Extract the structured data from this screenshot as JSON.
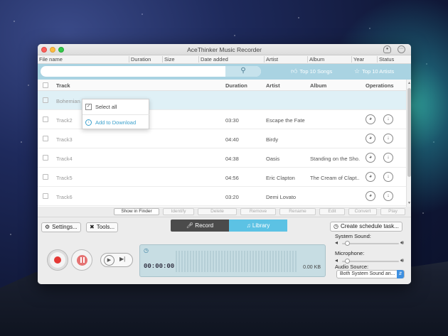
{
  "window": {
    "title": "AceThinker Music Recorder"
  },
  "columns_top": [
    "File name",
    "Duration",
    "Size",
    "Date added",
    "Artist",
    "Album",
    "Year",
    "Status"
  ],
  "search": {
    "placeholder": "",
    "top_songs": "Top 10 Songs",
    "top_artists": "Top 10 Artists"
  },
  "table": {
    "headers": {
      "track": "Track",
      "duration": "Duration",
      "artist": "Artist",
      "album": "Album",
      "operations": "Operations"
    },
    "rows": [
      {
        "track": "Bohemian Rhapsody",
        "duration": "",
        "artist": "",
        "album": "",
        "selected": true
      },
      {
        "track": "Track2",
        "duration": "03:30",
        "artist": "Escape the Fate",
        "album": ""
      },
      {
        "track": "Track3",
        "duration": "04:40",
        "artist": "Birdy",
        "album": ""
      },
      {
        "track": "Track4",
        "duration": "04:38",
        "artist": "Oasis",
        "album": "Standing on the Sho..."
      },
      {
        "track": "Track5",
        "duration": "04:56",
        "artist": "Eric Clapton",
        "album": "The Cream of Clapt..."
      },
      {
        "track": "Track6",
        "duration": "03:20",
        "artist": "Demi Lovato",
        "album": ""
      }
    ]
  },
  "context_menu": {
    "select_all": "Select all",
    "add_to_download": "Add to Download"
  },
  "actions": {
    "show_in_finder": "Show in Finder",
    "identify": "Identify",
    "delete": "Delete",
    "remove": "Remove",
    "rename": "Rename",
    "edit": "Edit",
    "convert": "Convert",
    "play": "Play"
  },
  "controls": {
    "settings": "Settings...",
    "tools": "Tools...",
    "record_tab": "Record",
    "library_tab": "Library",
    "schedule": "Create schedule task...",
    "time": "00:00:00",
    "size": "0.00 KB",
    "system_sound": "System Sound:",
    "microphone": "Microphone:",
    "audio_source": "Audio Source:",
    "audio_source_value": "Both System Sound an...",
    "system_sound_level": 0.05,
    "microphone_level": 0.05
  },
  "icons": {
    "search": "search-icon",
    "thumbs_up": "thumbs-up-icon",
    "star": "star-icon",
    "user": "user-icon",
    "chat": "chat-icon",
    "headphones": "headphones-icon",
    "download": "download-icon",
    "gear": "gear-icon",
    "tools": "tools-icon",
    "microphone": "microphone-icon",
    "music": "music-note-icon",
    "clock": "clock-icon",
    "speaker": "speaker-icon"
  },
  "colors": {
    "accent": "#5cc2e4",
    "record": "#e53935",
    "search_bar": "#a9d3e2"
  }
}
